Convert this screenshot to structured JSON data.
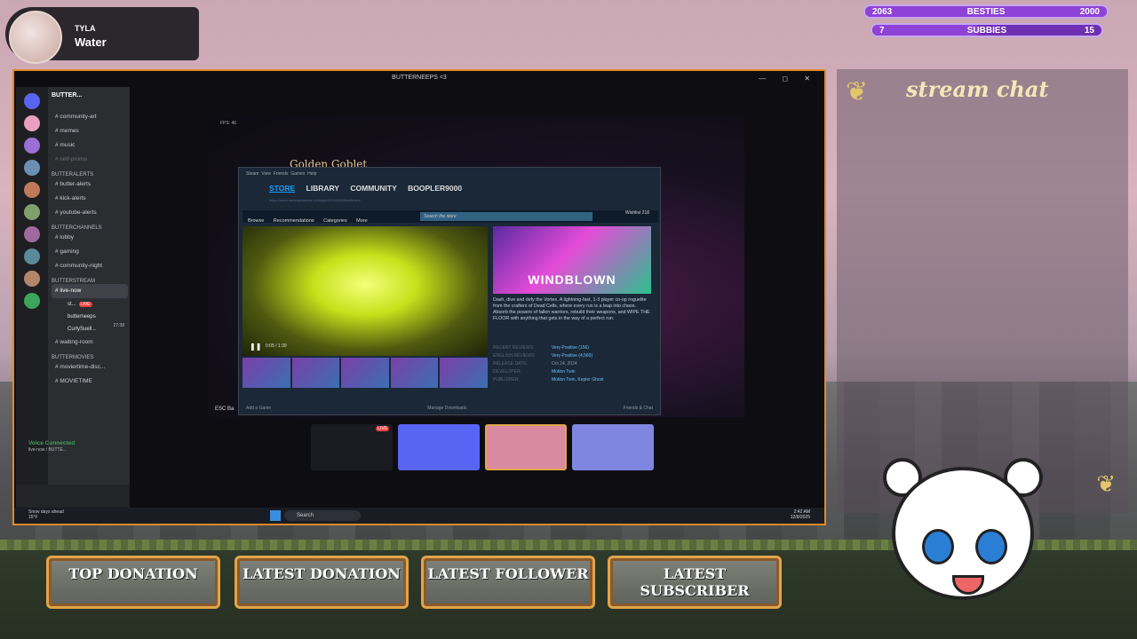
{
  "now_playing": {
    "artist": "TYLA",
    "song": "Water"
  },
  "goals": [
    {
      "name": "BESTIES",
      "current": "2063",
      "target": "2000",
      "progress": 1.0
    },
    {
      "name": "SUBBIES",
      "current": "7",
      "target": "15",
      "progress": 0.47
    }
  ],
  "chat": {
    "title": "stream chat"
  },
  "window": {
    "title": "BUTTERNEEPS <3"
  },
  "discord": {
    "server": "BUTTER...",
    "channels": [
      {
        "kind": "ch",
        "label": "community-art"
      },
      {
        "kind": "ch",
        "label": "memes"
      },
      {
        "kind": "ch",
        "label": "music"
      },
      {
        "kind": "ch-muted",
        "label": "self-promo"
      },
      {
        "kind": "cat",
        "label": "BUTTERALERTS"
      },
      {
        "kind": "ch",
        "label": "butter-alerts"
      },
      {
        "kind": "ch",
        "label": "kick-alerts"
      },
      {
        "kind": "ch",
        "label": "youtube-alerts"
      },
      {
        "kind": "cat",
        "label": "BUTTERCHANNELS"
      },
      {
        "kind": "ch",
        "label": "lobby"
      },
      {
        "kind": "ch",
        "label": "gaming"
      },
      {
        "kind": "ch",
        "label": "community-night"
      },
      {
        "kind": "cat",
        "label": "BUTTERSTREAM"
      },
      {
        "kind": "ch-active",
        "label": "live-now"
      }
    ],
    "voice_users": [
      "st...",
      "butterneeps",
      "CurlySuell..."
    ],
    "live_badge": "LIVE",
    "voice_timer": "27:38",
    "channels2": [
      {
        "kind": "ch",
        "label": "waiting-room"
      },
      {
        "kind": "cat",
        "label": "BUTTERMOVIES"
      },
      {
        "kind": "ch",
        "label": "moviertime-disc..."
      },
      {
        "kind": "ch",
        "label": "MOVIETIME"
      }
    ],
    "voice_status": "Voice Connected",
    "voice_sub": "live-now / BUTTE..."
  },
  "game": {
    "title": "Golden Goblet",
    "fps": "FPS: 46",
    "esc": "ESC Ba"
  },
  "steam": {
    "menu": [
      "Steam",
      "View",
      "Friends",
      "Games",
      "Help"
    ],
    "tabs": [
      "STORE",
      "LIBRARY",
      "COMMUNITY",
      "BOOPLER9000"
    ],
    "user": "BOOPLER9000",
    "url": "https://store.steampowered.com/app/2311650/Windblown/",
    "nav": [
      "Browse",
      "Recommendations",
      "Categories",
      "More"
    ],
    "search_placeholder": "Search the store",
    "wishlist": "Wishlist 218",
    "video_time": "0:05 / 1:39",
    "capsule": "WINDBLOWN",
    "description": "Dash, dive and defy the Vortex. A lightning-fast, 1-3 player co-op roguelite from the crafters of Dead Cells, where every run is a leap into chaos. Absorb the powers of fallen warriors, rebuild their weapons, and WIPE THE FLOOR with anything that gets in the way of a perfect run.",
    "meta": [
      {
        "k": "RECENT REVIEWS:",
        "v": "Very Positive (156)"
      },
      {
        "k": "ENGLISH REVIEWS:",
        "v": "Very Positive (4,560)"
      },
      {
        "k": "RELEASE DATE:",
        "v": "Oct 24, 2024"
      },
      {
        "k": "DEVELOPER:",
        "v": "Motion Twin"
      },
      {
        "k": "PUBLISHER:",
        "v": "Motion Twin, Kepler Ghost"
      }
    ],
    "footer": {
      "add": "Add a Game",
      "downloads": "Manage Downloads",
      "friends": "Friends & Chat"
    }
  },
  "dock_live": "LIVE",
  "taskbar": {
    "weather": "Snow days ahead",
    "weather_temp": "15°F",
    "search": "Search",
    "time": "2:42 AM",
    "date": "12/8/2025"
  },
  "labels": {
    "top_donation": "TOP DONATION",
    "latest_donation": "LATEST DONATION",
    "latest_follower": "LATEST FOLLOWER",
    "latest_subscriber": "LATEST SUBSCRIBER"
  },
  "colors": {
    "accent_orange": "#e08a2a",
    "goal_purple": "#8e43d6",
    "steam_blue": "#1a9fff"
  }
}
